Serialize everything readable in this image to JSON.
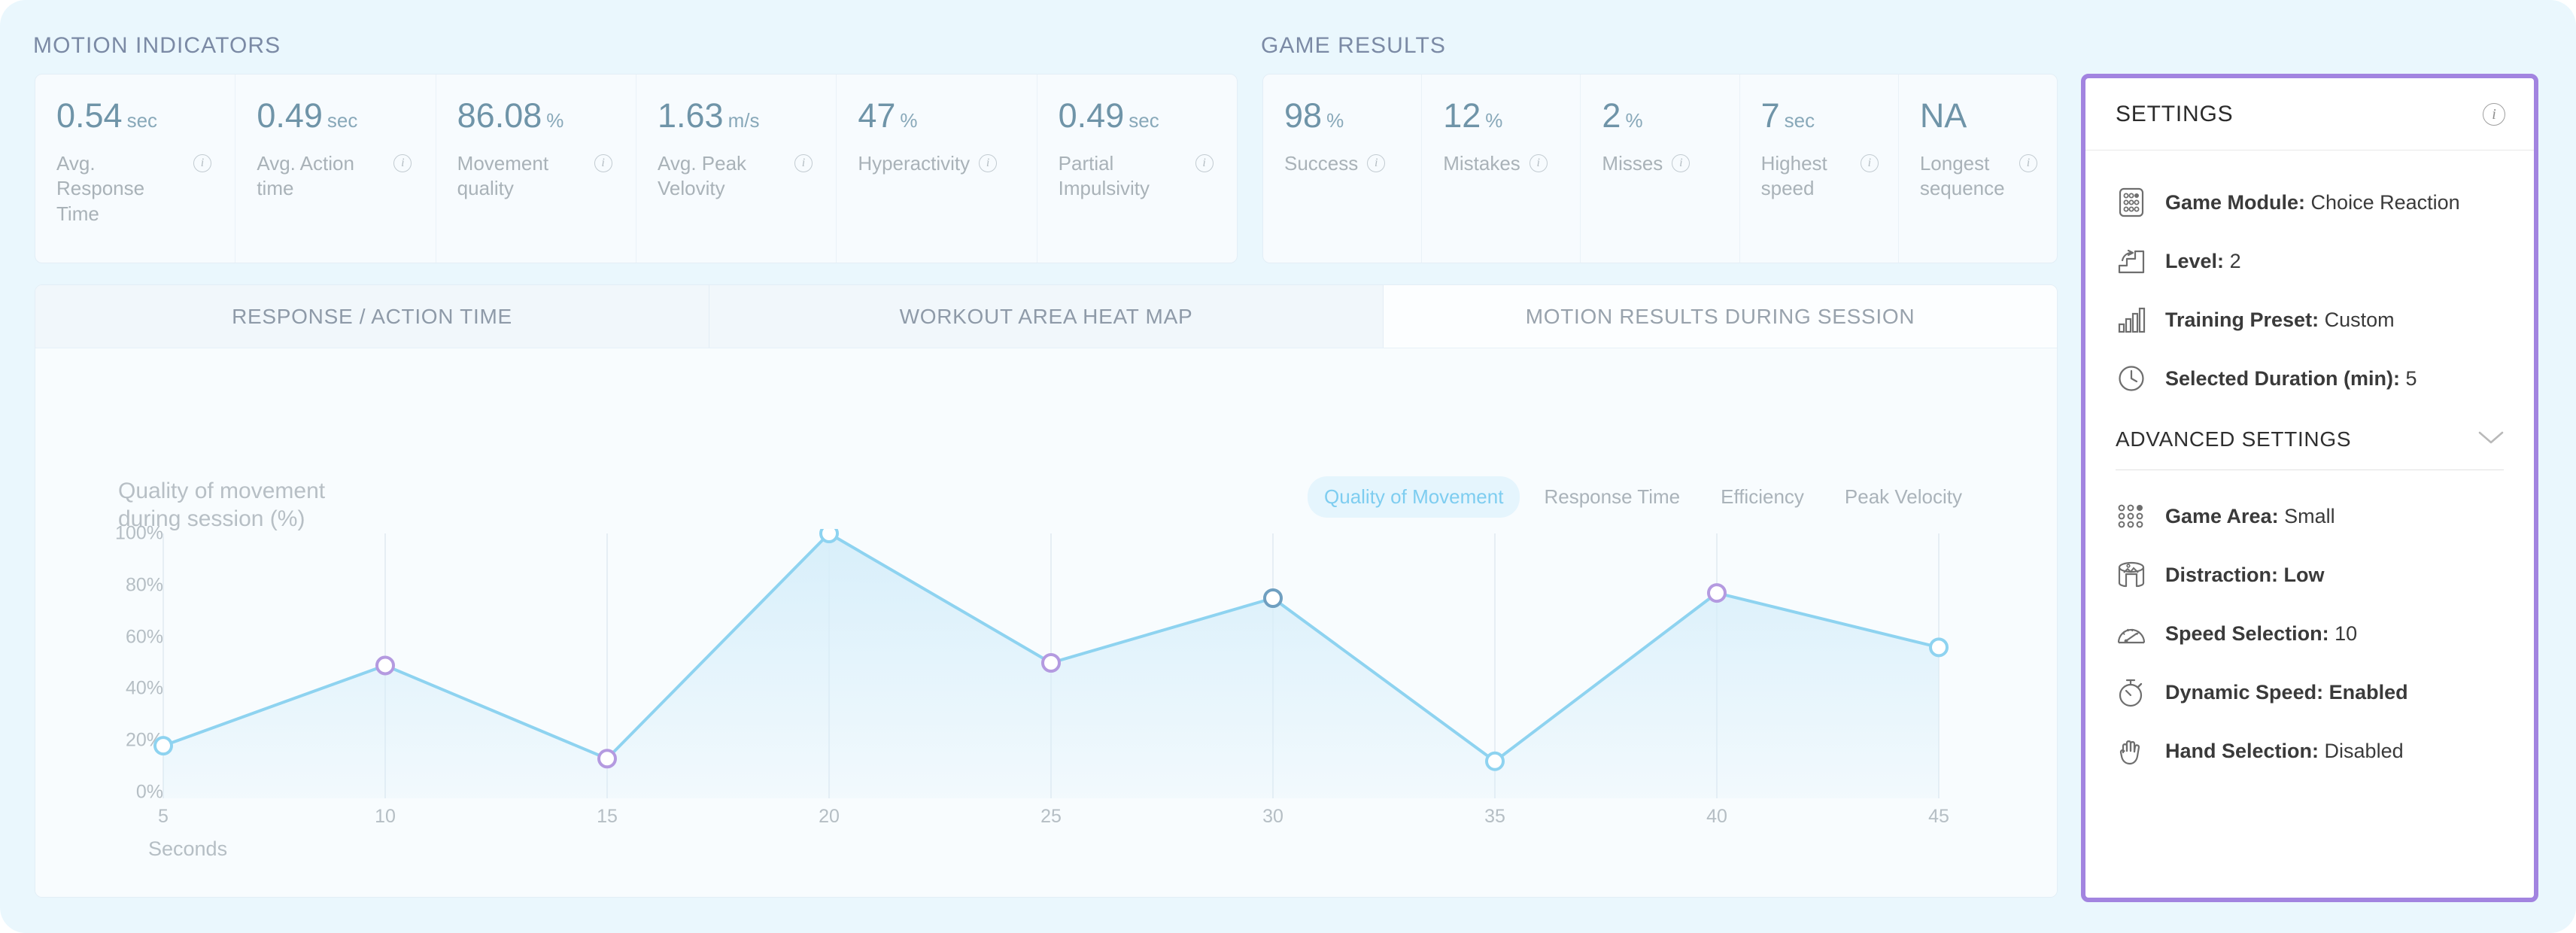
{
  "sections": {
    "motion_title": "MOTION INDICATORS",
    "game_title": "GAME RESULTS"
  },
  "motion_indicators": [
    {
      "value": "0.54",
      "unit": "sec",
      "label": "Avg. Response Time",
      "info": "i"
    },
    {
      "value": "0.49",
      "unit": "sec",
      "label": "Avg. Action time",
      "info": "i"
    },
    {
      "value": "86.08",
      "unit": "%",
      "label": "Movement quality",
      "info": "i"
    },
    {
      "value": "1.63",
      "unit": "m/s",
      "label": "Avg. Peak Velovity",
      "info": "i"
    },
    {
      "value": "47",
      "unit": "%",
      "label": "Hyperactivity",
      "info": "i"
    },
    {
      "value": "0.49",
      "unit": "sec",
      "label": "Partial Impulsivity",
      "info": "i"
    }
  ],
  "game_results": [
    {
      "value": "98",
      "unit": "%",
      "label": "Success",
      "info": "i"
    },
    {
      "value": "12",
      "unit": "%",
      "label": "Mistakes",
      "info": "i"
    },
    {
      "value": "2",
      "unit": "%",
      "label": "Misses",
      "info": "i"
    },
    {
      "value": "7",
      "unit": "sec",
      "label": "Highest speed",
      "info": "i"
    },
    {
      "value": "NA",
      "unit": "",
      "label": "Longest sequence",
      "info": "i"
    }
  ],
  "tabs": [
    {
      "label": "RESPONSE / ACTION TIME",
      "active": false
    },
    {
      "label": "WORKOUT AREA HEAT MAP",
      "active": false
    },
    {
      "label": "MOTION RESULTS DURING SESSION",
      "active": true
    }
  ],
  "chart_panel": {
    "heading_line1": "Quality of movement",
    "heading_line2": "during session (%)",
    "filters": [
      {
        "label": "Quality of Movement",
        "active": true
      },
      {
        "label": "Response Time",
        "active": false
      },
      {
        "label": "Efficiency",
        "active": false
      },
      {
        "label": "Peak Velocity",
        "active": false
      }
    ]
  },
  "chart_data": {
    "type": "line",
    "title": "Quality of movement during session (%)",
    "xlabel": "Seconds",
    "ylabel": "",
    "x": [
      5,
      10,
      15,
      20,
      25,
      30,
      35,
      40,
      45
    ],
    "xticklabels": [
      "5",
      "10",
      "15",
      "20",
      "25",
      "30",
      "35",
      "40",
      "45"
    ],
    "yticklabels": [
      "100%",
      "80%",
      "60%",
      "40%",
      "20%",
      "0%"
    ],
    "ylim": [
      0,
      100
    ],
    "xlim": [
      5,
      45
    ],
    "grid": "vertical",
    "legend": "none",
    "series": [
      {
        "name": "Quality of Movement",
        "values": [
          18,
          49,
          13,
          100,
          50,
          75,
          12,
          77,
          56
        ],
        "line_color": "#8ed3f0",
        "fill_color": "#d6eefa",
        "marker_colors": [
          "#8ed3f0",
          "#b49ae0",
          "#b49ae0",
          "#8ed3f0",
          "#b49ae0",
          "#6f9fc0",
          "#8ed3f0",
          "#b49ae0",
          "#8ed3f0"
        ]
      }
    ]
  },
  "settings": {
    "title": "SETTINGS",
    "info_icon": "i",
    "items": [
      {
        "icon": "dice-grid-icon",
        "label": "Game Module:",
        "value": "Choice Reaction",
        "all_bold": false
      },
      {
        "icon": "stairs-arrow-icon",
        "label": "Level:",
        "value": "2",
        "all_bold": false
      },
      {
        "icon": "bar-chart-icon",
        "label": "Training Preset:",
        "value": "Custom",
        "all_bold": false
      },
      {
        "icon": "clock-icon",
        "label": "Selected Duration (min):",
        "value": "5",
        "all_bold": false
      }
    ],
    "advanced": {
      "label": "ADVANCED SETTINGS",
      "chevron": "chevron-down-icon",
      "items": [
        {
          "icon": "dot-grid-icon",
          "label": "Game Area:",
          "value": "Small",
          "all_bold": false
        },
        {
          "icon": "cylinder-image-icon",
          "label": "Distraction: Low",
          "value": "",
          "all_bold": true
        },
        {
          "icon": "speedometer-icon",
          "label": "Speed Selection:",
          "value": "10",
          "all_bold": false
        },
        {
          "icon": "stopwatch-icon",
          "label": "Dynamic Speed: Enabled",
          "value": "",
          "all_bold": true
        },
        {
          "icon": "hand-icon",
          "label": "Hand Selection:",
          "value": "Disabled",
          "all_bold": false
        }
      ]
    }
  },
  "colors": {
    "page_bg": "#eaf7fd",
    "panel_bg": "#f7fbfe",
    "accent_blue": "#8ed3f0",
    "accent_purple": "#a284e0",
    "metric_value": "#6f94a8",
    "muted_text": "#a9b2b8"
  }
}
